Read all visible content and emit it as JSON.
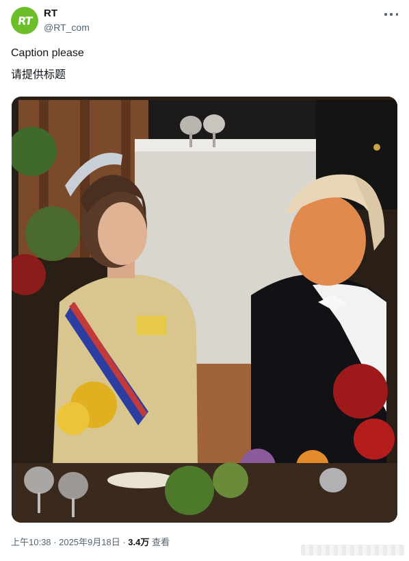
{
  "author": {
    "display_name": "RT",
    "handle": "@RT_com",
    "avatar_text": "RT",
    "avatar_color": "#6cbf2a"
  },
  "more_icon": "more-horizontal-icon",
  "post": {
    "text_line_1": "Caption please",
    "text_line_2": "请提供标题"
  },
  "meta": {
    "time": "上午10:38",
    "sep1": " · ",
    "date": "2025年9月18日",
    "sep2": " · ",
    "views_count": "3.4万",
    "views_label": " 查看"
  }
}
